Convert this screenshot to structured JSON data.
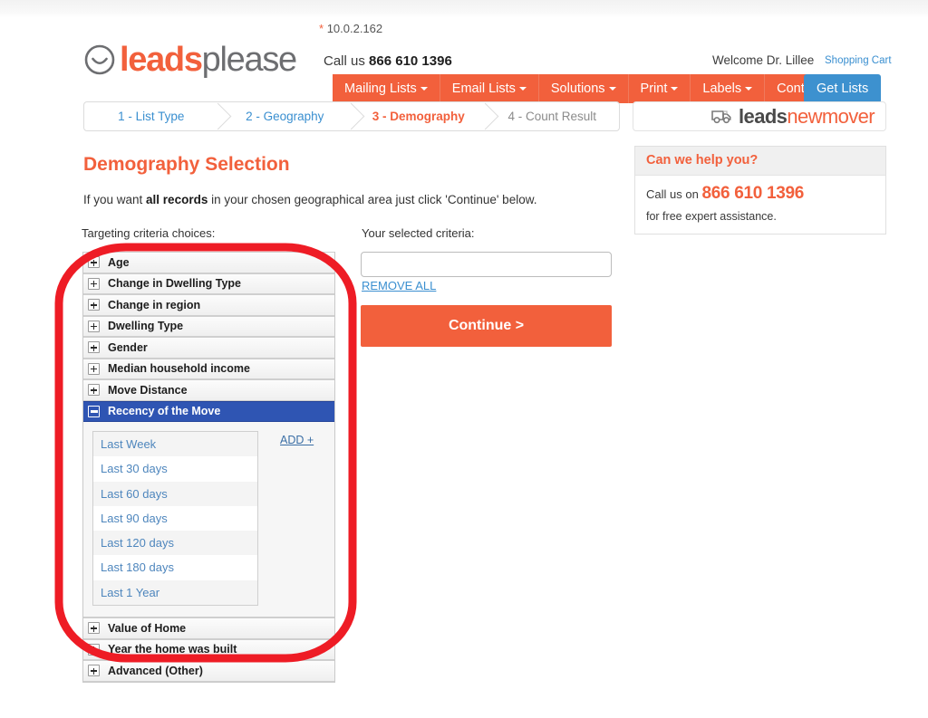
{
  "header": {
    "ip_star": "*",
    "ip_address": "10.0.2.162",
    "call_us_label": "Call us",
    "call_us_number": "866 610 1396",
    "welcome": "Welcome Dr. Lillee",
    "shopping_cart": "Shopping Cart",
    "logo": {
      "part1": "leads",
      "part2": "please",
      "icon": "smiley-face-icon"
    },
    "nav": [
      {
        "label": "Mailing Lists",
        "has_caret": true
      },
      {
        "label": "Email Lists",
        "has_caret": true
      },
      {
        "label": "Solutions",
        "has_caret": true
      },
      {
        "label": "Print",
        "has_caret": true
      },
      {
        "label": "Labels",
        "has_caret": true
      },
      {
        "label": "Contact",
        "has_caret": false
      }
    ],
    "get_lists_button": "Get Lists",
    "colors": {
      "brand_orange": "#f2603c",
      "link_blue": "#3a8fd0",
      "button_blue": "#3d91cf"
    }
  },
  "steps": [
    {
      "label": "1 - List Type",
      "state": "done"
    },
    {
      "label": "2 - Geography",
      "state": "done"
    },
    {
      "label": "3 - Demography",
      "state": "active"
    },
    {
      "label": "4 - Count Result",
      "state": "pending"
    }
  ],
  "brand_badge": {
    "part1": "leads",
    "part2": "newmover",
    "icon": "moving-truck-icon"
  },
  "help_box": {
    "title": "Can we help you?",
    "call_prefix": "Call us on",
    "phone": "866 610 1396",
    "subtext": "for free expert assistance."
  },
  "main": {
    "page_title": "Demography Selection",
    "intro_before": "If you want ",
    "intro_bold": "all records",
    "intro_after": " in your chosen geographical area just click 'Continue' below.",
    "left_label": "Targeting criteria choices:",
    "right_label": "Your selected criteria:",
    "criteria_input_value": "",
    "criteria_input_placeholder": "",
    "remove_all": "REMOVE ALL",
    "continue_button": "Continue >",
    "accordion": [
      {
        "label": "Age",
        "open": false
      },
      {
        "label": "Change in Dwelling Type",
        "open": false
      },
      {
        "label": "Change in region",
        "open": false
      },
      {
        "label": "Dwelling Type",
        "open": false
      },
      {
        "label": "Gender",
        "open": false
      },
      {
        "label": "Median household income",
        "open": false
      },
      {
        "label": "Move Distance",
        "open": false
      },
      {
        "label": "Recency of the Move",
        "open": true
      },
      {
        "label": "Value of Home",
        "open": false
      },
      {
        "label": "Year the home was built",
        "open": false
      },
      {
        "label": "Advanced (Other)",
        "open": false
      }
    ],
    "recency_options": [
      "Last Week",
      "Last 30 days",
      "Last 60 days",
      "Last 90 days",
      "Last 120 days",
      "Last 180 days",
      "Last 1 Year"
    ],
    "add_link": "ADD +"
  },
  "annotation": {
    "shape": "red-rounded-rect-highlight",
    "color": "#ee1c25"
  }
}
